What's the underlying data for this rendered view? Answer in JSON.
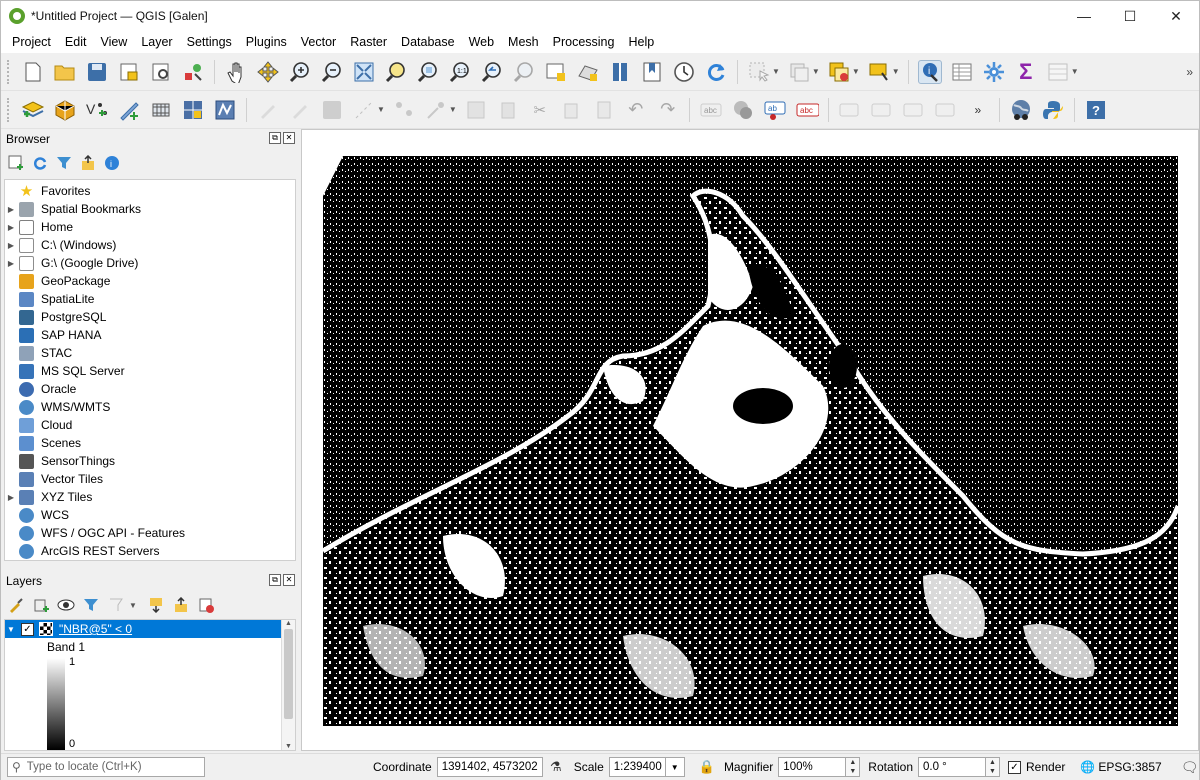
{
  "app": {
    "title": "*Untitled Project — QGIS [Galen]"
  },
  "menu": [
    "Project",
    "Edit",
    "View",
    "Layer",
    "Settings",
    "Plugins",
    "Vector",
    "Raster",
    "Database",
    "Web",
    "Mesh",
    "Processing",
    "Help"
  ],
  "toolbar1_icons": [
    "new-project-icon",
    "open-project-icon",
    "save-project-icon",
    "save-as-icon",
    "print-layout-icon",
    "style-manager-icon",
    "pan-icon",
    "pan-to-selection-icon",
    "zoom-in-icon",
    "zoom-out-icon",
    "zoom-full-icon",
    "zoom-to-selection-icon",
    "zoom-to-layer-icon",
    "zoom-native-icon",
    "zoom-last-icon",
    "zoom-next-icon",
    "new-map-view-icon",
    "new-3d-view-icon",
    "temporal-controller-icon",
    "bookmark-icon",
    "show-bookmarks-icon",
    "refresh-icon",
    "select-features-icon",
    "deselect-icon",
    "select-by-expression-icon",
    "annotation-icon",
    "identify-icon",
    "attribute-table-icon",
    "settings-gear-icon",
    "statistics-sum-icon",
    "field-calculator-icon"
  ],
  "toolbar2_icons": [
    "data-source-manager-icon",
    "new-geopackage-icon",
    "new-shapefile-icon",
    "new-spatialite-icon",
    "new-temporary-layer-icon",
    "new-virtual-layer-icon",
    "new-mesh-layer-icon",
    "toggle-editing-icon",
    "current-edits-icon",
    "save-edits-icon",
    "digitize-icon",
    "vertex-tool-icon",
    "multi-edit-icon",
    "delete-selected-icon",
    "cut-features-icon",
    "copy-features-icon",
    "paste-features-icon",
    "undo-icon",
    "redo-icon",
    "label-icon",
    "layer-labeling-icon",
    "pin-labels-icon",
    "highlight-labels-icon",
    "show-labels-icon",
    "move-label-icon",
    "rotate-label-icon",
    "change-label-icon",
    "world-map-icon",
    "python-icon",
    "help-icon"
  ],
  "browser": {
    "title": "Browser",
    "items": [
      {
        "label": "Favorites",
        "icon": "star-icon",
        "expandable": false,
        "color": "#f2c21b"
      },
      {
        "label": "Spatial Bookmarks",
        "icon": "bookmark-icon",
        "expandable": true,
        "color": "#9aa4ad"
      },
      {
        "label": "Home",
        "icon": "home-icon",
        "expandable": true,
        "color": "#7f7f7f"
      },
      {
        "label": "C:\\ (Windows)",
        "icon": "drive-icon",
        "expandable": true,
        "color": "#8d8d8d"
      },
      {
        "label": "G:\\ (Google Drive)",
        "icon": "drive-icon",
        "expandable": true,
        "color": "#8d8d8d"
      },
      {
        "label": "GeoPackage",
        "icon": "geopackage-icon",
        "expandable": false,
        "color": "#e7a31b"
      },
      {
        "label": "SpatiaLite",
        "icon": "spatialite-icon",
        "expandable": false,
        "color": "#5b87c4"
      },
      {
        "label": "PostgreSQL",
        "icon": "postgresql-icon",
        "expandable": false,
        "color": "#336791"
      },
      {
        "label": "SAP HANA",
        "icon": "sap-hana-icon",
        "expandable": false,
        "color": "#2b6fb5"
      },
      {
        "label": "STAC",
        "icon": "stac-icon",
        "expandable": false,
        "color": "#8fa2b8"
      },
      {
        "label": "MS SQL Server",
        "icon": "mssql-icon",
        "expandable": false,
        "color": "#3673b8"
      },
      {
        "label": "Oracle",
        "icon": "oracle-icon",
        "expandable": false,
        "color": "#3c6bb0"
      },
      {
        "label": "WMS/WMTS",
        "icon": "wms-globe-icon",
        "expandable": false,
        "color": "#4a8ac7"
      },
      {
        "label": "Cloud",
        "icon": "cloud-icon",
        "expandable": false,
        "color": "#6f9fd8"
      },
      {
        "label": "Scenes",
        "icon": "scenes-icon",
        "expandable": false,
        "color": "#5c8fcf"
      },
      {
        "label": "SensorThings",
        "icon": "sensor-icon",
        "expandable": false,
        "color": "#555555"
      },
      {
        "label": "Vector Tiles",
        "icon": "vector-tiles-icon",
        "expandable": false,
        "color": "#5a80b5"
      },
      {
        "label": "XYZ Tiles",
        "icon": "xyz-tiles-icon",
        "expandable": true,
        "color": "#5a80b5"
      },
      {
        "label": "WCS",
        "icon": "wcs-globe-icon",
        "expandable": false,
        "color": "#4a8ac7"
      },
      {
        "label": "WFS / OGC API - Features",
        "icon": "wfs-globe-icon",
        "expandable": false,
        "color": "#4a8ac7"
      },
      {
        "label": "ArcGIS REST Servers",
        "icon": "arcgis-globe-icon",
        "expandable": false,
        "color": "#4a8ac7"
      }
    ]
  },
  "layers": {
    "title": "Layers",
    "layer_name": "\"NBR@5\" < 0",
    "band": "Band 1",
    "legend_max": "1",
    "legend_min": "0"
  },
  "status": {
    "locate_placeholder": "Type to locate (Ctrl+K)",
    "coordinate_label": "Coordinate",
    "coordinate_value": "1391402, 4573202",
    "scale_label": "Scale",
    "scale_value": "1:239400",
    "magnifier_label": "Magnifier",
    "magnifier_value": "100%",
    "rotation_label": "Rotation",
    "rotation_value": "0.0 °",
    "render_label": "Render",
    "crs": "EPSG:3857"
  }
}
